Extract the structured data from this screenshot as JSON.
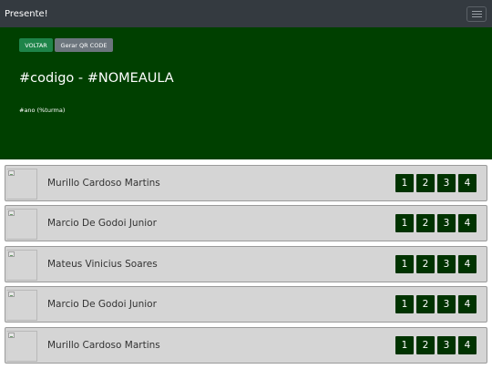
{
  "navbar": {
    "brand": "Presente!",
    "menu_icon": "hamburger-menu-icon"
  },
  "hero": {
    "back_label": "VOLTAR",
    "qr_label": "Gerar QR CODE",
    "title": "#codigo - #NOMEAULA",
    "subtitle": "#ano (%turma)",
    "colors": {
      "background": "#004000",
      "back_button": "#1e8449",
      "qr_button": "#6c757d"
    }
  },
  "students": [
    {
      "name": "Murillo Cardoso Martins",
      "grades": [
        "1",
        "2",
        "3",
        "4"
      ]
    },
    {
      "name": "Marcio De Godoi Junior",
      "grades": [
        "1",
        "2",
        "3",
        "4"
      ]
    },
    {
      "name": "Mateus Vinicius Soares",
      "grades": [
        "1",
        "2",
        "3",
        "4"
      ]
    },
    {
      "name": "Marcio De Godoi Junior",
      "grades": [
        "1",
        "2",
        "3",
        "4"
      ]
    },
    {
      "name": "Murillo Cardoso Martins",
      "grades": [
        "1",
        "2",
        "3",
        "4"
      ]
    }
  ]
}
